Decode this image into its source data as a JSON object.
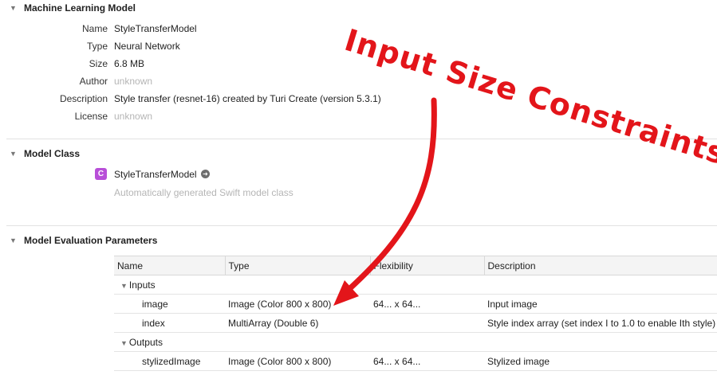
{
  "model": {
    "header": "Machine Learning Model",
    "props": [
      {
        "label": "Name",
        "value": "StyleTransferModel",
        "muted": false
      },
      {
        "label": "Type",
        "value": "Neural Network",
        "muted": false
      },
      {
        "label": "Size",
        "value": "6.8 MB",
        "muted": false
      },
      {
        "label": "Author",
        "value": "unknown",
        "muted": true
      },
      {
        "label": "Description",
        "value": "Style transfer (resnet-16) created by Turi Create (version 5.3.1)",
        "muted": false
      },
      {
        "label": "License",
        "value": "unknown",
        "muted": true
      }
    ]
  },
  "model_class": {
    "header": "Model Class",
    "badge": "C",
    "name": "StyleTransferModel",
    "subtitle": "Automatically generated Swift model class",
    "badge_color": "#b84fd8"
  },
  "eval_params": {
    "header": "Model Evaluation Parameters",
    "columns": [
      "Name",
      "Type",
      "Flexibility",
      "Description"
    ],
    "groups": [
      {
        "label": "Inputs",
        "rows": [
          {
            "name": "image",
            "type": "Image (Color 800 x 800)",
            "flex": "64... x 64...",
            "desc": "Input image"
          },
          {
            "name": "index",
            "type": "MultiArray (Double 6)",
            "flex": "",
            "desc": "Style index array (set index I to 1.0 to enable Ith style)"
          }
        ]
      },
      {
        "label": "Outputs",
        "rows": [
          {
            "name": "stylizedImage",
            "type": "Image (Color 800 x 800)",
            "flex": "64... x 64...",
            "desc": "Stylized image"
          }
        ]
      }
    ]
  },
  "annotation": {
    "text": "Input Size Constraints",
    "color": "#e3151a"
  }
}
